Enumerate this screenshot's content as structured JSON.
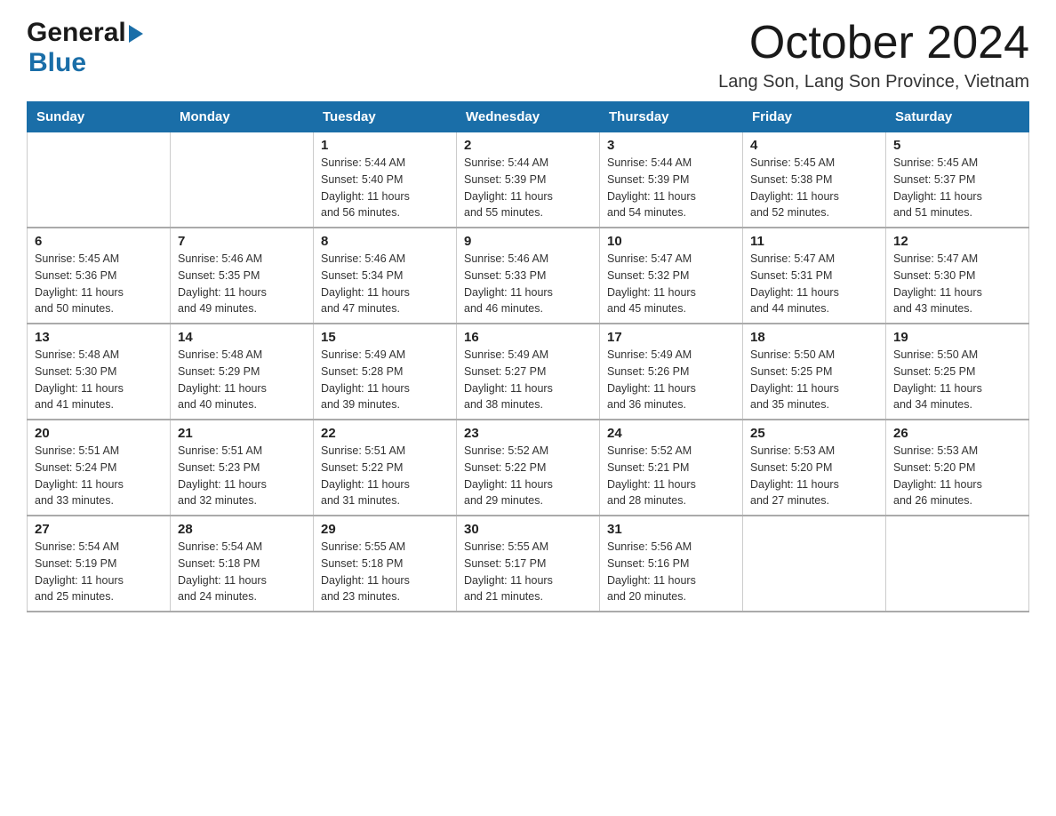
{
  "header": {
    "logo_general": "General",
    "logo_blue": "Blue",
    "title": "October 2024",
    "subtitle": "Lang Son, Lang Son Province, Vietnam"
  },
  "days_of_week": [
    "Sunday",
    "Monday",
    "Tuesday",
    "Wednesday",
    "Thursday",
    "Friday",
    "Saturday"
  ],
  "weeks": [
    [
      {
        "day": "",
        "info": ""
      },
      {
        "day": "",
        "info": ""
      },
      {
        "day": "1",
        "info": "Sunrise: 5:44 AM\nSunset: 5:40 PM\nDaylight: 11 hours\nand 56 minutes."
      },
      {
        "day": "2",
        "info": "Sunrise: 5:44 AM\nSunset: 5:39 PM\nDaylight: 11 hours\nand 55 minutes."
      },
      {
        "day": "3",
        "info": "Sunrise: 5:44 AM\nSunset: 5:39 PM\nDaylight: 11 hours\nand 54 minutes."
      },
      {
        "day": "4",
        "info": "Sunrise: 5:45 AM\nSunset: 5:38 PM\nDaylight: 11 hours\nand 52 minutes."
      },
      {
        "day": "5",
        "info": "Sunrise: 5:45 AM\nSunset: 5:37 PM\nDaylight: 11 hours\nand 51 minutes."
      }
    ],
    [
      {
        "day": "6",
        "info": "Sunrise: 5:45 AM\nSunset: 5:36 PM\nDaylight: 11 hours\nand 50 minutes."
      },
      {
        "day": "7",
        "info": "Sunrise: 5:46 AM\nSunset: 5:35 PM\nDaylight: 11 hours\nand 49 minutes."
      },
      {
        "day": "8",
        "info": "Sunrise: 5:46 AM\nSunset: 5:34 PM\nDaylight: 11 hours\nand 47 minutes."
      },
      {
        "day": "9",
        "info": "Sunrise: 5:46 AM\nSunset: 5:33 PM\nDaylight: 11 hours\nand 46 minutes."
      },
      {
        "day": "10",
        "info": "Sunrise: 5:47 AM\nSunset: 5:32 PM\nDaylight: 11 hours\nand 45 minutes."
      },
      {
        "day": "11",
        "info": "Sunrise: 5:47 AM\nSunset: 5:31 PM\nDaylight: 11 hours\nand 44 minutes."
      },
      {
        "day": "12",
        "info": "Sunrise: 5:47 AM\nSunset: 5:30 PM\nDaylight: 11 hours\nand 43 minutes."
      }
    ],
    [
      {
        "day": "13",
        "info": "Sunrise: 5:48 AM\nSunset: 5:30 PM\nDaylight: 11 hours\nand 41 minutes."
      },
      {
        "day": "14",
        "info": "Sunrise: 5:48 AM\nSunset: 5:29 PM\nDaylight: 11 hours\nand 40 minutes."
      },
      {
        "day": "15",
        "info": "Sunrise: 5:49 AM\nSunset: 5:28 PM\nDaylight: 11 hours\nand 39 minutes."
      },
      {
        "day": "16",
        "info": "Sunrise: 5:49 AM\nSunset: 5:27 PM\nDaylight: 11 hours\nand 38 minutes."
      },
      {
        "day": "17",
        "info": "Sunrise: 5:49 AM\nSunset: 5:26 PM\nDaylight: 11 hours\nand 36 minutes."
      },
      {
        "day": "18",
        "info": "Sunrise: 5:50 AM\nSunset: 5:25 PM\nDaylight: 11 hours\nand 35 minutes."
      },
      {
        "day": "19",
        "info": "Sunrise: 5:50 AM\nSunset: 5:25 PM\nDaylight: 11 hours\nand 34 minutes."
      }
    ],
    [
      {
        "day": "20",
        "info": "Sunrise: 5:51 AM\nSunset: 5:24 PM\nDaylight: 11 hours\nand 33 minutes."
      },
      {
        "day": "21",
        "info": "Sunrise: 5:51 AM\nSunset: 5:23 PM\nDaylight: 11 hours\nand 32 minutes."
      },
      {
        "day": "22",
        "info": "Sunrise: 5:51 AM\nSunset: 5:22 PM\nDaylight: 11 hours\nand 31 minutes."
      },
      {
        "day": "23",
        "info": "Sunrise: 5:52 AM\nSunset: 5:22 PM\nDaylight: 11 hours\nand 29 minutes."
      },
      {
        "day": "24",
        "info": "Sunrise: 5:52 AM\nSunset: 5:21 PM\nDaylight: 11 hours\nand 28 minutes."
      },
      {
        "day": "25",
        "info": "Sunrise: 5:53 AM\nSunset: 5:20 PM\nDaylight: 11 hours\nand 27 minutes."
      },
      {
        "day": "26",
        "info": "Sunrise: 5:53 AM\nSunset: 5:20 PM\nDaylight: 11 hours\nand 26 minutes."
      }
    ],
    [
      {
        "day": "27",
        "info": "Sunrise: 5:54 AM\nSunset: 5:19 PM\nDaylight: 11 hours\nand 25 minutes."
      },
      {
        "day": "28",
        "info": "Sunrise: 5:54 AM\nSunset: 5:18 PM\nDaylight: 11 hours\nand 24 minutes."
      },
      {
        "day": "29",
        "info": "Sunrise: 5:55 AM\nSunset: 5:18 PM\nDaylight: 11 hours\nand 23 minutes."
      },
      {
        "day": "30",
        "info": "Sunrise: 5:55 AM\nSunset: 5:17 PM\nDaylight: 11 hours\nand 21 minutes."
      },
      {
        "day": "31",
        "info": "Sunrise: 5:56 AM\nSunset: 5:16 PM\nDaylight: 11 hours\nand 20 minutes."
      },
      {
        "day": "",
        "info": ""
      },
      {
        "day": "",
        "info": ""
      }
    ]
  ]
}
